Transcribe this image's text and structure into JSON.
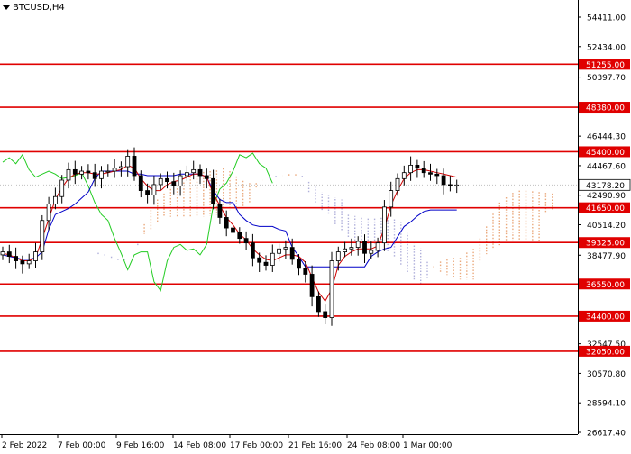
{
  "symbol_label": "BTCUSD,H4",
  "current_price": "43178.20",
  "chart_data": {
    "type": "candlestick",
    "title": "BTCUSD,H4",
    "y_axis_ticks": [
      "54411.00",
      "52434.00",
      "50397.70",
      "48380.00",
      "46444.30",
      "44467.60",
      "42490.90",
      "40514.20",
      "38477.90",
      "36550.00",
      "34400.00",
      "32547.50",
      "30570.80",
      "28594.10",
      "26617.40"
    ],
    "y_tick_values": [
      54411.0,
      52434.0,
      50397.7,
      48380.0,
      46444.3,
      44467.6,
      42490.9,
      40514.2,
      38477.9,
      36550.0,
      34400.0,
      32547.5,
      30570.8,
      28594.1,
      26617.4
    ],
    "x_axis_ticks": [
      "2 Feb 2022",
      "7 Feb 00:00",
      "9 Feb 16:00",
      "14 Feb 08:00",
      "17 Feb 00:00",
      "21 Feb 16:00",
      "24 Feb 08:00",
      "1 Mar 00:00"
    ],
    "horizontal_levels": [
      {
        "value": 51255.0,
        "label": "51255.00"
      },
      {
        "value": 48380.0,
        "label": "48380.00"
      },
      {
        "value": 45400.0,
        "label": "45400.00"
      },
      {
        "value": 41650.0,
        "label": "41650.00"
      },
      {
        "value": 39325.0,
        "label": "39325.00"
      },
      {
        "value": 36550.0,
        "label": "36550.00"
      },
      {
        "value": 34400.0,
        "label": "34400.00"
      },
      {
        "value": 32050.0,
        "label": "32050.00"
      }
    ],
    "indicators": [
      "Ichimoku Kinko Hyo"
    ],
    "series": [
      {
        "name": "Close",
        "values": [
          38700,
          38400,
          38100,
          37900,
          38100,
          38700,
          40800,
          41900,
          42400,
          43500,
          44200,
          43900,
          44100,
          44000,
          43600,
          44100,
          44100,
          44300,
          44400,
          45100,
          43800,
          42800,
          42500,
          43200,
          43600,
          43400,
          43100,
          43800,
          44000,
          44200,
          43800,
          43600,
          41900,
          41000,
          40300,
          40000,
          39600,
          39300,
          38300,
          38000,
          37800,
          38600,
          38900,
          39000,
          38200,
          37600,
          37200,
          35700,
          34700,
          34300,
          38100,
          38700,
          38900,
          39000,
          39400,
          38600,
          38800,
          39300,
          41700,
          42800,
          43600,
          44000,
          44500,
          44300,
          44000,
          43900,
          43800,
          43200,
          43100,
          43178
        ]
      },
      {
        "name": "Tenkan-sen",
        "values": [
          38600,
          38500,
          38300,
          38100,
          38100,
          38300,
          39600,
          40900,
          42200,
          43000,
          43600,
          43900,
          44000,
          44000,
          43900,
          43900,
          44000,
          44100,
          44200,
          44500,
          44300,
          43600,
          43100,
          42800,
          42800,
          43200,
          43400,
          43500,
          43700,
          43900,
          43900,
          43700,
          42600,
          41800,
          41000,
          40500,
          39900,
          39500,
          38900,
          38500,
          38200,
          38100,
          38300,
          38500,
          38500,
          38400,
          38000,
          37000,
          36000,
          35400,
          36200,
          37800,
          38400,
          38700,
          38900,
          38900,
          38900,
          39100,
          40300,
          41800,
          42800,
          43600,
          44000,
          44200,
          44200,
          44100,
          44000,
          43900,
          43800,
          43700
        ]
      },
      {
        "name": "Kijun-sen",
        "values": [
          38500,
          38400,
          38300,
          38200,
          38200,
          38300,
          38700,
          40200,
          41200,
          41400,
          41600,
          41900,
          42300,
          42700,
          43600,
          44100,
          44100,
          44100,
          44100,
          44100,
          43900,
          43900,
          43800,
          43800,
          43800,
          43800,
          43800,
          43900,
          43900,
          43900,
          43900,
          43700,
          42800,
          42200,
          42000,
          42000,
          41200,
          40800,
          40500,
          40400,
          40400,
          40400,
          40200,
          40100,
          39000,
          38400,
          37700,
          37700,
          37700,
          37700,
          37700,
          37700,
          37700,
          37700,
          37700,
          37700,
          38400,
          38700,
          38900,
          39000,
          39700,
          40400,
          40700,
          41100,
          41400,
          41500,
          41500,
          41500,
          41500,
          41500
        ]
      },
      {
        "name": "Chikou Span",
        "values": [
          44700,
          45000,
          44600,
          45200,
          44200,
          43700,
          43900,
          44100,
          43900,
          43600,
          43700,
          43800,
          44000,
          43100,
          42000,
          41200,
          40800,
          39600,
          38600,
          37500,
          38500,
          38700,
          38700,
          36700,
          36100,
          38100,
          39000,
          39200,
          38800,
          38900,
          38500,
          39200,
          41800,
          42900,
          43300,
          44100,
          45200,
          45000,
          45300,
          44600,
          44300,
          43300
        ]
      }
    ],
    "grid": false,
    "legend": "none"
  }
}
